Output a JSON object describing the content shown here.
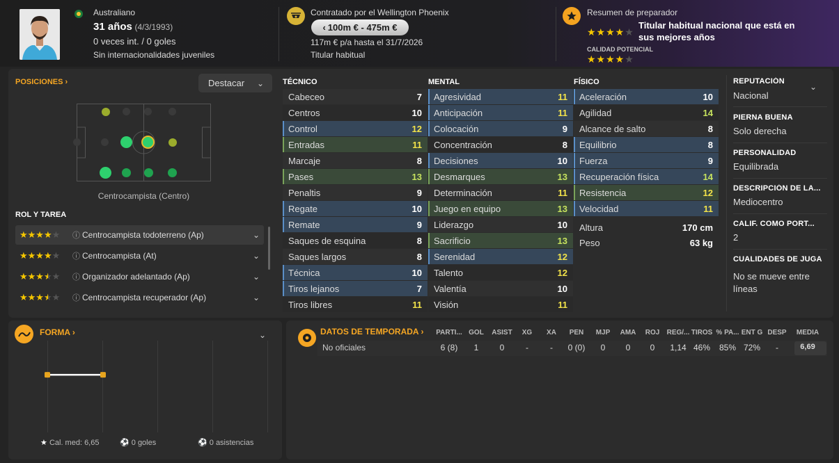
{
  "header": {
    "nationality": "Australiano",
    "age": "31 años",
    "dob": "(4/3/1993)",
    "intl": "0 veces int. / 0 goles",
    "youth": "Sin internacionalidades juveniles",
    "contract_title": "Contratado por el Wellington Phoenix",
    "value": "100m € - 475m €",
    "wage": "117m € p/a hasta el 31/7/2026",
    "status": "Titular habitual",
    "coach_title": "Resumen de preparador",
    "coach_summary": "Titular habitual nacional que está en sus mejores años",
    "potential_label": "CALIDAD POTENCIAL",
    "current_stars": 4,
    "potential_stars": 4
  },
  "positions": {
    "title": "POSICIONES",
    "highlight_button": "Destacar",
    "position_label": "Centrocampista (Centro)"
  },
  "roles": {
    "title": "ROL Y TAREA",
    "items": [
      {
        "name": "Centrocampista todoterreno (Ap)",
        "stars": 4
      },
      {
        "name": "Centrocampista (At)",
        "stars": 4
      },
      {
        "name": "Organizador adelantado (Ap)",
        "stars": 3.5
      },
      {
        "name": "Centrocampista recuperador (Ap)",
        "stars": 3.5
      }
    ]
  },
  "attributes": {
    "technical_title": "TÉCNICO",
    "mental_title": "MENTAL",
    "physical_title": "FÍSICO",
    "technical": [
      {
        "name": "Cabeceo",
        "value": "7"
      },
      {
        "name": "Centros",
        "value": "10"
      },
      {
        "name": "Control",
        "value": "12"
      },
      {
        "name": "Entradas",
        "value": "11"
      },
      {
        "name": "Marcaje",
        "value": "8"
      },
      {
        "name": "Pases",
        "value": "13"
      },
      {
        "name": "Penaltis",
        "value": "9"
      },
      {
        "name": "Regate",
        "value": "10"
      },
      {
        "name": "Remate",
        "value": "9"
      },
      {
        "name": "Saques de esquina",
        "value": "8"
      },
      {
        "name": "Saques largos",
        "value": "8"
      },
      {
        "name": "Técnica",
        "value": "10"
      },
      {
        "name": "Tiros lejanos",
        "value": "7"
      },
      {
        "name": "Tiros libres",
        "value": "11"
      }
    ],
    "mental": [
      {
        "name": "Agresividad",
        "value": "11"
      },
      {
        "name": "Anticipación",
        "value": "11"
      },
      {
        "name": "Colocación",
        "value": "9"
      },
      {
        "name": "Concentración",
        "value": "8"
      },
      {
        "name": "Decisiones",
        "value": "10"
      },
      {
        "name": "Desmarques",
        "value": "13"
      },
      {
        "name": "Determinación",
        "value": "11"
      },
      {
        "name": "Juego en equipo",
        "value": "13"
      },
      {
        "name": "Liderazgo",
        "value": "10"
      },
      {
        "name": "Sacrificio",
        "value": "13"
      },
      {
        "name": "Serenidad",
        "value": "12"
      },
      {
        "name": "Talento",
        "value": "12"
      },
      {
        "name": "Valentía",
        "value": "10"
      },
      {
        "name": "Visión",
        "value": "11"
      }
    ],
    "physical": [
      {
        "name": "Aceleración",
        "value": "10"
      },
      {
        "name": "Agilidad",
        "value": "14"
      },
      {
        "name": "Alcance de salto",
        "value": "8"
      },
      {
        "name": "Equilibrio",
        "value": "8"
      },
      {
        "name": "Fuerza",
        "value": "9"
      },
      {
        "name": "Recuperación física",
        "value": "14"
      },
      {
        "name": "Resistencia",
        "value": "12"
      },
      {
        "name": "Velocidad",
        "value": "11"
      }
    ],
    "height_label": "Altura",
    "height_value": "170 cm",
    "weight_label": "Peso",
    "weight_value": "63 kg"
  },
  "side": {
    "reputation_label": "REPUTACIÓN",
    "reputation_value": "Nacional",
    "foot_label": "PIERNA BUENA",
    "foot_value": "Solo derecha",
    "personality_label": "PERSONALIDAD",
    "personality_value": "Equilibrada",
    "description_label": "DESCRIPCIÓN DE LA...",
    "description_value": "Mediocentro",
    "gk_label": "CALIF. COMO PORT...",
    "gk_value": "2",
    "qualities_label": "CUALIDADES DE JUGA",
    "qualities_value": "No se mueve entre líneas"
  },
  "form": {
    "title": "FORMA",
    "avg_rating": "Cal. med: 6,65",
    "goals": "0 goles",
    "assists": "0 asistencias",
    "chart_data": {
      "type": "line",
      "series": [
        {
          "values": [
            6.65,
            6.65
          ]
        }
      ]
    }
  },
  "season": {
    "title": "DATOS DE TEMPORADA",
    "headers": [
      "PARTI...",
      "GOL",
      "ASIST",
      "XG",
      "XA",
      "PEN",
      "MJP",
      "AMA",
      "ROJ",
      "REG/...",
      "TIROS",
      "% PA...",
      "ENT G",
      "DESP",
      "MEDIA"
    ],
    "row_label": "No oficiales",
    "values": [
      "6 (8)",
      "1",
      "0",
      "-",
      "-",
      "0 (0)",
      "0",
      "0",
      "0",
      "1,14",
      "46%",
      "85%",
      "72%",
      "-",
      "6,69"
    ]
  },
  "colors": {
    "accent": "#f5a623",
    "highlight_blue": "#36475a",
    "highlight_green": "#3a4a39"
  }
}
